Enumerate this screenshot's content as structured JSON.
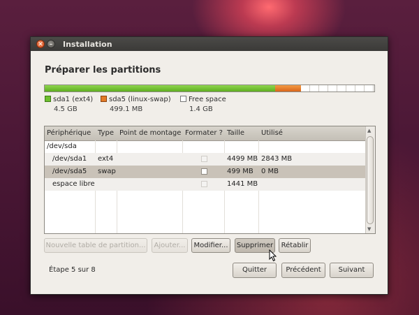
{
  "window": {
    "title": "Installation"
  },
  "page": {
    "heading": "Préparer les partitions"
  },
  "disk_bar": {
    "segments": [
      {
        "name": "sda1 (ext4)",
        "size": "4.5 GB",
        "fraction": 0.7,
        "color": "#6fbf2f"
      },
      {
        "name": "sda5 (linux-swap)",
        "size": "499.1 MB",
        "fraction": 0.077,
        "color": "#e37a26"
      },
      {
        "name": "Free space",
        "size": "1.4 GB",
        "fraction": 0.223,
        "color": "#ffffff"
      }
    ]
  },
  "table": {
    "headers": [
      "Périphérique",
      "Type",
      "Point de montage",
      "Formater ?",
      "Taille",
      "Utilisé"
    ],
    "rows": [
      {
        "device": "/dev/sda",
        "type": "",
        "mount": "",
        "format": "",
        "size": "",
        "used": ""
      },
      {
        "device": "/dev/sda1",
        "type": "ext4",
        "mount": "",
        "format": "unchecked",
        "size": "4499 MB",
        "used": "2843 MB"
      },
      {
        "device": "/dev/sda5",
        "type": "swap",
        "mount": "",
        "format": "unchecked",
        "size": "499 MB",
        "used": "0 MB"
      },
      {
        "device": "espace libre",
        "type": "",
        "mount": "",
        "format": "unchecked",
        "size": "1441 MB",
        "used": ""
      }
    ]
  },
  "actions": {
    "new_table": "Nouvelle table de partition...",
    "add": "Ajouter...",
    "modify": "Modifier...",
    "delete": "Supprimer",
    "revert": "Rétablir"
  },
  "footer": {
    "step": "Étape 5 sur 8",
    "quit": "Quitter",
    "previous": "Précédent",
    "next": "Suivant"
  }
}
